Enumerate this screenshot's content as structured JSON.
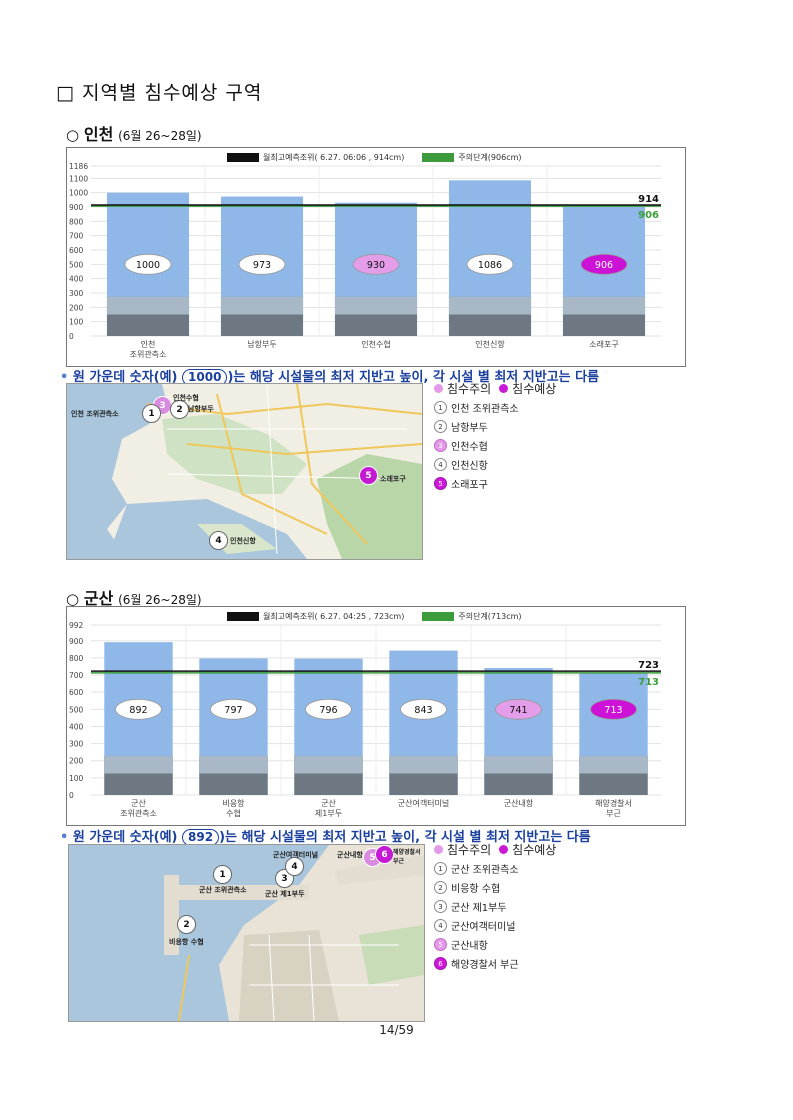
{
  "page_title": "□ 지역별 침수예상 구역",
  "sections": [
    {
      "title_mark": "○",
      "title_region": "인천",
      "title_period": "(6월 26~28일)",
      "legend_black": "월최고예측조위( 6.27. 06:06 , 914cm)",
      "legend_green": "주의단계(906cm)",
      "note_pre": "원 가운데 숫자(예)",
      "note_example": "1000",
      "note_post": ")는 해당 시설물의 최저 지반고 높이, 각 시설 별 최저 지반고는 다름",
      "map_legend_header": {
        "warn": "침수주의",
        "flood": "침수예상"
      },
      "map_legend_items": [
        {
          "num": "1",
          "label": "인천 조위관측소",
          "status": "normal"
        },
        {
          "num": "2",
          "label": "남항부두",
          "status": "normal"
        },
        {
          "num": "3",
          "label": "인천수협",
          "status": "warn"
        },
        {
          "num": "4",
          "label": "인천신항",
          "status": "normal"
        },
        {
          "num": "5",
          "label": "소래포구",
          "status": "flood"
        }
      ],
      "map_labels": [
        "인천 조위관측소",
        "남항부두",
        "인천수협",
        "소래포구",
        "인천신항"
      ]
    },
    {
      "title_mark": "○",
      "title_region": "군산",
      "title_period": "(6월 26~28일)",
      "legend_black": "월최고예측조위( 6.27. 04:25 , 723cm)",
      "legend_green": "주의단계(713cm)",
      "note_pre": "원 가운데 숫자(예)",
      "note_example": "892",
      "note_post": ")는 해당 시설물의 최저 지반고 높이, 각 시설 별 최저 지반고는 다름",
      "map_legend_header": {
        "warn": "침수주의",
        "flood": "침수예상"
      },
      "map_legend_items": [
        {
          "num": "1",
          "label": "군산 조위관측소",
          "status": "normal"
        },
        {
          "num": "2",
          "label": "비응항 수협",
          "status": "normal"
        },
        {
          "num": "3",
          "label": "군산 제1부두",
          "status": "normal"
        },
        {
          "num": "4",
          "label": "군산여객터미널",
          "status": "normal"
        },
        {
          "num": "5",
          "label": "군산내항",
          "status": "warn"
        },
        {
          "num": "6",
          "label": "해양경찰서 부근",
          "status": "flood"
        }
      ],
      "map_labels": [
        "군산 조위관측소",
        "비응항 수협",
        "군산 제1부두",
        "군산여객터미널",
        "군산내항",
        "해양경찰서 부근"
      ]
    }
  ],
  "chart_data": [
    {
      "type": "bar",
      "ylim": [
        0,
        1186
      ],
      "yticks": [
        "1186",
        "1100",
        "1000",
        "900",
        "800",
        "700",
        "600",
        "500",
        "400",
        "300",
        "200",
        "100",
        "0"
      ],
      "categories": [
        [
          "인천",
          "조위관측소"
        ],
        [
          "남항부두"
        ],
        [
          "인천수협"
        ],
        [
          "인천신항"
        ],
        [
          "소래포구"
        ]
      ],
      "values": [
        1000,
        973,
        930,
        1086,
        906
      ],
      "status": [
        "normal",
        "normal",
        "warn",
        "normal",
        "flood"
      ],
      "line_black": 914,
      "line_green": 906,
      "line_black_label": "914",
      "line_green_label": "906",
      "colors": {
        "bar": "#8fb8e8",
        "black": "#111111",
        "green": "#3c9c3c",
        "warn": "#e49de8",
        "flood": "#cc12d6"
      }
    },
    {
      "type": "bar",
      "ylim": [
        0,
        992
      ],
      "yticks": [
        "992",
        "900",
        "800",
        "700",
        "600",
        "500",
        "400",
        "300",
        "200",
        "100",
        "0"
      ],
      "categories": [
        [
          "군산",
          "조위관측소"
        ],
        [
          "비응항",
          "수협"
        ],
        [
          "군산",
          "제1부두"
        ],
        [
          "군산여객터미널"
        ],
        [
          "군산내항"
        ],
        [
          "해양경찰서",
          "부근"
        ]
      ],
      "values": [
        892,
        797,
        796,
        843,
        741,
        713
      ],
      "status": [
        "normal",
        "normal",
        "normal",
        "normal",
        "warn",
        "flood"
      ],
      "line_black": 723,
      "line_green": 713,
      "line_black_label": "723",
      "line_green_label": "713",
      "colors": {
        "bar": "#8fb8e8",
        "black": "#111111",
        "green": "#3c9c3c",
        "warn": "#e49de8",
        "flood": "#cc12d6"
      }
    }
  ],
  "page_number": "14/59"
}
